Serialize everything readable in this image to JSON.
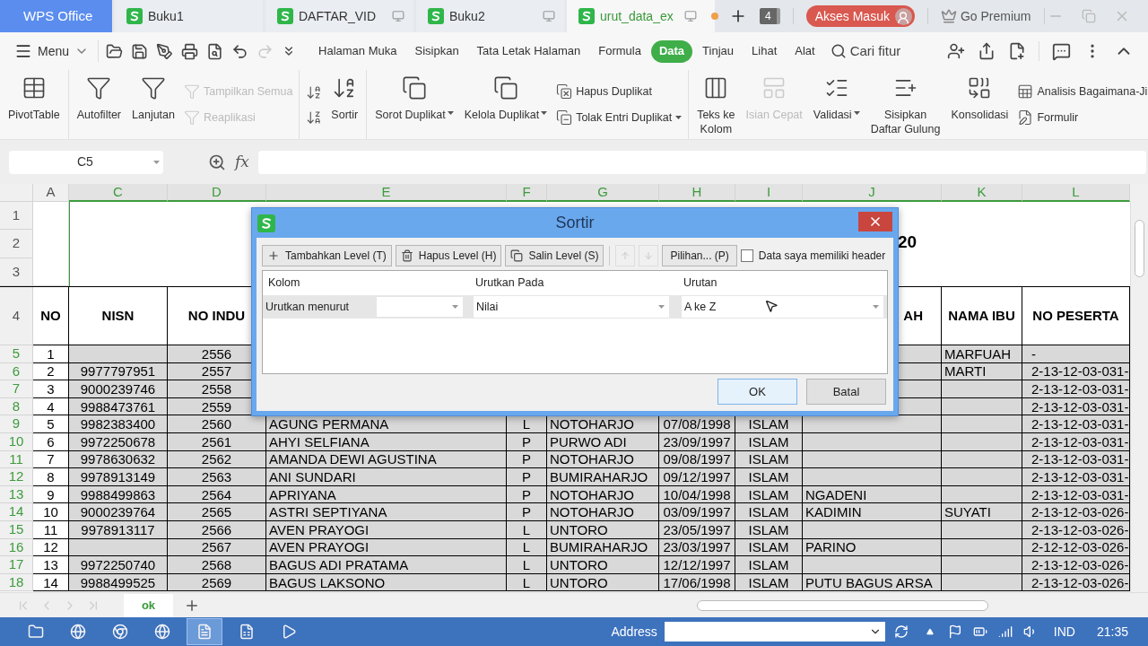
{
  "title_bar": {
    "tabs": [
      {
        "kind": "home",
        "label": "WPS Office",
        "selected": false
      },
      {
        "kind": "doc",
        "label": "Buku1",
        "selected": false,
        "screen_icon": false,
        "modified": false
      },
      {
        "kind": "doc",
        "label": "DAFTAR_VID",
        "selected": false,
        "screen_icon": true,
        "modified": false
      },
      {
        "kind": "doc",
        "label": "Buku2",
        "selected": false,
        "screen_icon": true,
        "modified": false
      },
      {
        "kind": "doc",
        "label": "urut_data_ex",
        "selected": true,
        "screen_icon": true,
        "modified": true
      }
    ],
    "tab_count": "4",
    "account_button": "Akses Masuk",
    "premium_button": "Go Premium"
  },
  "menu_bar": {
    "menu_label": "Menu",
    "quick_access": [
      {
        "disabled": false
      },
      {
        "disabled": false
      },
      {
        "disabled": false
      },
      {
        "disabled": false
      },
      {
        "disabled": false
      },
      {
        "disabled": false
      },
      {
        "disabled": true
      },
      {
        "disabled": false
      }
    ],
    "tabs": [
      {
        "label": "Halaman Muka",
        "selected": false
      },
      {
        "label": "Sisipkan",
        "selected": false
      },
      {
        "label": "Tata Letak Halaman",
        "selected": false
      },
      {
        "label": "Formula",
        "selected": false
      },
      {
        "label": "Data",
        "selected": true
      },
      {
        "label": "Tinjau",
        "selected": false
      },
      {
        "label": "Lihat",
        "selected": false
      },
      {
        "label": "Alat",
        "selected": false
      }
    ],
    "search_label": "Cari fitur"
  },
  "ribbon": {
    "groups": [
      {
        "items": [
          {
            "kind": "large",
            "label": "PivotTable",
            "disabled": false,
            "dropdown": false
          }
        ]
      },
      {
        "items": [
          {
            "kind": "large",
            "label": "Autofilter",
            "disabled": false,
            "dropdown": false
          },
          {
            "kind": "large",
            "label": "Lanjutan",
            "disabled": false,
            "dropdown": false
          },
          {
            "kind": "stack",
            "items": [
              {
                "label": "Tampilkan Semua",
                "disabled": true,
                "dropdown": false
              },
              {
                "label": "Reaplikasi",
                "disabled": true,
                "dropdown": false
              }
            ]
          }
        ]
      },
      {
        "items": [
          {
            "kind": "stack",
            "items": [
              {
                "disabled": false,
                "dropdown": false
              },
              {
                "disabled": false,
                "dropdown": false
              }
            ]
          },
          {
            "kind": "large",
            "label": "Sortir",
            "disabled": false,
            "dropdown": false
          }
        ]
      },
      {
        "items": [
          {
            "kind": "large",
            "label": "Sorot Duplikat",
            "disabled": false,
            "dropdown": true
          },
          {
            "kind": "large",
            "label": "Kelola Duplikat",
            "disabled": false,
            "dropdown": true
          },
          {
            "kind": "stack",
            "items": [
              {
                "label": "Hapus Duplikat",
                "disabled": false,
                "dropdown": false
              },
              {
                "label": "Tolak Entri Duplikat",
                "disabled": false,
                "dropdown": true
              }
            ]
          }
        ]
      },
      {
        "items": [
          {
            "kind": "large",
            "label": "Teks ke\nKolom",
            "disabled": false,
            "dropdown": false
          },
          {
            "kind": "large",
            "label": "Isian Cepat",
            "disabled": true,
            "dropdown": false
          },
          {
            "kind": "large",
            "label": "Validasi",
            "disabled": false,
            "dropdown": true
          },
          {
            "kind": "large",
            "label": "Sisipkan\nDaftar Gulung",
            "disabled": false,
            "dropdown": false
          },
          {
            "kind": "large",
            "label": "Konsolidasi",
            "disabled": false,
            "dropdown": false
          },
          {
            "kind": "stack",
            "items": [
              {
                "label": "Analisis Bagaimana-Ji",
                "disabled": false,
                "dropdown": false
              },
              {
                "label": "Formulir",
                "disabled": false,
                "dropdown": false
              }
            ]
          }
        ]
      }
    ]
  },
  "formula_bar": {
    "name_box": "C5",
    "fx_label": "fx"
  },
  "sheet": {
    "columns": [
      {
        "letter": "A",
        "selected": false
      },
      {
        "letter": "C",
        "selected": true
      },
      {
        "letter": "D",
        "selected": true
      },
      {
        "letter": "E",
        "selected": true
      },
      {
        "letter": "F",
        "selected": true
      },
      {
        "letter": "G",
        "selected": true
      },
      {
        "letter": "H",
        "selected": true
      },
      {
        "letter": "I",
        "selected": true
      },
      {
        "letter": "J",
        "selected": true
      },
      {
        "letter": "K",
        "selected": true
      },
      {
        "letter": "L",
        "selected": true
      }
    ],
    "title_rows": [
      "1",
      "2",
      "3"
    ],
    "title_fragment": "20",
    "header_row": {
      "number": "4",
      "cells": [
        "NO",
        "NISN",
        "NO INDU",
        null,
        null,
        null,
        null,
        null,
        "AH",
        "NAMA IBU",
        "NO PESERTA"
      ]
    },
    "rows": [
      {
        "number": "5",
        "selected": true,
        "cells": [
          "1",
          null,
          "2556",
          null,
          null,
          null,
          null,
          null,
          null,
          "MARFUAH",
          "-"
        ]
      },
      {
        "number": "6",
        "selected": true,
        "cells": [
          "2",
          "9977797951",
          "2557",
          null,
          null,
          null,
          null,
          null,
          null,
          "MARTI",
          "2-13-12-03-031-"
        ]
      },
      {
        "number": "7",
        "selected": true,
        "cells": [
          "3",
          "9000239746",
          "2558",
          null,
          null,
          null,
          null,
          null,
          null,
          null,
          "2-13-12-03-031-"
        ]
      },
      {
        "number": "8",
        "selected": true,
        "cells": [
          "4",
          "9988473761",
          "2559",
          null,
          null,
          null,
          null,
          null,
          null,
          null,
          "2-13-12-03-031-"
        ]
      },
      {
        "number": "9",
        "selected": true,
        "cells": [
          "5",
          "9982383400",
          "2560",
          "AGUNG PERMANA",
          "L",
          "NOTOHARJO",
          "07/08/1998",
          "ISLAM",
          null,
          null,
          "2-13-12-03-031-"
        ]
      },
      {
        "number": "10",
        "selected": true,
        "cells": [
          "6",
          "9972250678",
          "2561",
          "AHYI SELFIANA",
          "P",
          "PURWO ADI",
          "23/09/1997",
          "ISLAM",
          null,
          null,
          "2-13-12-03-031-"
        ]
      },
      {
        "number": "11",
        "selected": true,
        "cells": [
          "7",
          "9978630632",
          "2562",
          "AMANDA DEWI AGUSTINA",
          "P",
          "NOTOHARJO",
          "09/08/1997",
          "ISLAM",
          null,
          null,
          "2-13-12-03-031-"
        ]
      },
      {
        "number": "12",
        "selected": true,
        "cells": [
          "8",
          "9978913149",
          "2563",
          "ANI SUNDARI",
          "P",
          "BUMIRAHARJO",
          "09/12/1997",
          "ISLAM",
          null,
          null,
          "2-13-12-03-031-"
        ]
      },
      {
        "number": "13",
        "selected": true,
        "cells": [
          "9",
          "9988499863",
          "2564",
          "APRIYANA",
          "P",
          "NOTOHARJO",
          "10/04/1998",
          "ISLAM",
          "NGADENI",
          null,
          "2-13-12-03-031-"
        ]
      },
      {
        "number": "14",
        "selected": true,
        "cells": [
          "10",
          "9000239764",
          "2565",
          "ASTRI SEPTIYANA",
          "P",
          "NOTOHARJO",
          "03/09/1997",
          "ISLAM",
          "KADIMIN",
          "SUYATI",
          "2-13-12-03-026-"
        ]
      },
      {
        "number": "15",
        "selected": true,
        "cells": [
          "11",
          "9978913117",
          "2566",
          "AVEN PRAYOGI",
          "L",
          "UNTORO",
          "23/05/1997",
          "ISLAM",
          null,
          null,
          "2-13-12-03-026-"
        ]
      },
      {
        "number": "16",
        "selected": true,
        "cells": [
          "12",
          null,
          "2567",
          "AVEN PRAYOGI",
          "L",
          "BUMIRAHARJO",
          "23/03/1997",
          "ISLAM",
          "PARINO",
          null,
          "2-12-12-03-026-"
        ]
      },
      {
        "number": "17",
        "selected": true,
        "cells": [
          "13",
          "9972250740",
          "2568",
          "BAGUS ADI PRATAMA",
          "L",
          "UNTORO",
          "12/12/1997",
          "ISLAM",
          null,
          null,
          "2-13-12-03-026-"
        ]
      },
      {
        "number": "18",
        "selected": true,
        "cells": [
          "14",
          "9988499525",
          "2569",
          "BAGUS LAKSONO",
          "L",
          "UNTORO",
          "17/06/1998",
          "ISLAM",
          "PUTU BAGUS ARSA",
          null,
          "2-13-12-03-026-"
        ]
      }
    ]
  },
  "sort_dialog": {
    "title": "Sortir",
    "toolbar": [
      {
        "kind": "add",
        "label": "Tambahkan Level (T)"
      },
      {
        "kind": "delete",
        "label": "Hapus Level (H)"
      },
      {
        "kind": "copy",
        "label": "Salin Level (S)"
      }
    ],
    "move_buttons": [
      {
        "kind": "up",
        "disabled": true
      },
      {
        "kind": "down",
        "disabled": true
      }
    ],
    "options_button": "Pilihan... (P)",
    "header_checkbox": {
      "label": "Data saya memiliki header",
      "checked": false
    },
    "columns": [
      "Kolom",
      "Urutkan Pada",
      "Urutan"
    ],
    "levels": [
      {
        "label": "Urutkan menurut",
        "sort_on": "Nilai",
        "order": "A ke Z"
      }
    ],
    "buttons": [
      "OK",
      "Batal"
    ]
  },
  "sheet_tabs": [
    {
      "label": "ok",
      "selected": true
    }
  ],
  "taskbar": {
    "apps": [
      {
        "selected": false
      },
      {
        "selected": false
      },
      {
        "selected": false
      },
      {
        "selected": false
      },
      {
        "selected": true
      },
      {
        "selected": false
      },
      {
        "selected": false
      }
    ],
    "address_label": "Address",
    "language": "IND",
    "time": "21:35"
  }
}
